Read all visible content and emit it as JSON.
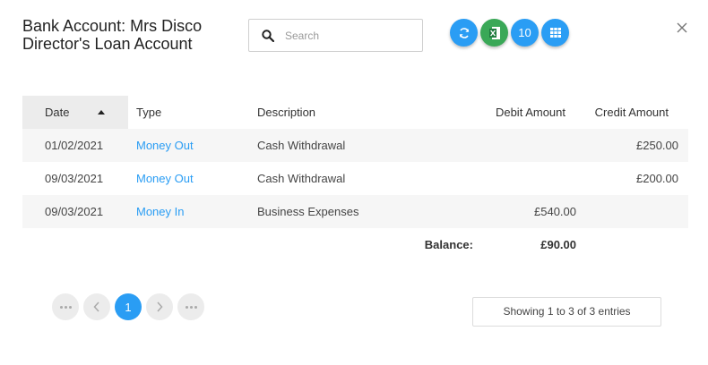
{
  "header": {
    "title_line1": "Bank Account: Mrs Disco",
    "title_line2": "Director's Loan Account"
  },
  "search": {
    "placeholder": "Search",
    "value": ""
  },
  "toolbar": {
    "refresh_icon": "refresh-icon",
    "excel_icon": "excel-icon",
    "page_size": "10",
    "grid_icon": "grid-icon"
  },
  "table": {
    "columns": [
      "Date",
      "Type",
      "Description",
      "Debit Amount",
      "Credit Amount"
    ],
    "rows": [
      {
        "date": "01/02/2021",
        "type": "Money Out",
        "description": "Cash Withdrawal",
        "debit": "",
        "credit": "£250.00"
      },
      {
        "date": "09/03/2021",
        "type": "Money Out",
        "description": "Cash Withdrawal",
        "debit": "",
        "credit": "£200.00"
      },
      {
        "date": "09/03/2021",
        "type": "Money In",
        "description": "Business Expenses",
        "debit": "£540.00",
        "credit": ""
      }
    ],
    "balance_label": "Balance:",
    "balance_value": "£90.00"
  },
  "pagination": {
    "current_page": "1"
  },
  "footer": {
    "info": "Showing 1 to 3 of 3 entries"
  },
  "colors": {
    "accent": "#2a9df4",
    "excel": "#3aa857"
  }
}
